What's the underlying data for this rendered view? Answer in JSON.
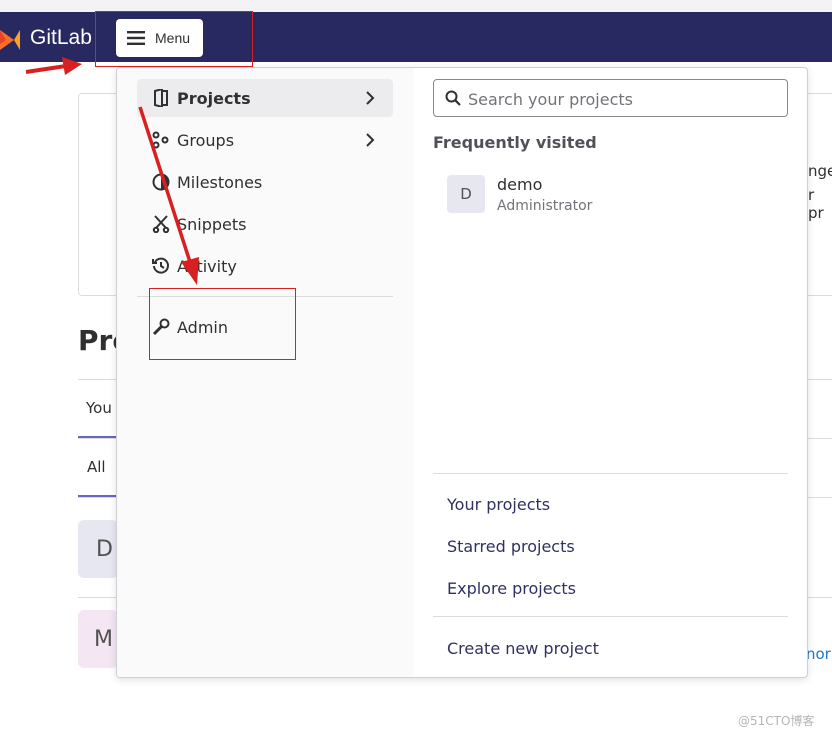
{
  "header": {
    "brand": "GitLab",
    "menu_label": "Menu"
  },
  "background": {
    "card_text_1": "nge",
    "card_text_2": "r pr",
    "title": "Pro",
    "tab_1": "You",
    "tab_2": "All",
    "avatar_1": "D",
    "avatar_2": "M",
    "more_link": "nor"
  },
  "menu": {
    "nav_items": [
      {
        "label": "Projects",
        "icon": "project-icon",
        "has_chevron": true,
        "active": true
      },
      {
        "label": "Groups",
        "icon": "group-icon",
        "has_chevron": true,
        "active": false
      },
      {
        "label": "Milestones",
        "icon": "milestone-icon",
        "has_chevron": false,
        "active": false
      },
      {
        "label": "Snippets",
        "icon": "snippet-icon",
        "has_chevron": false,
        "active": false
      },
      {
        "label": "Activity",
        "icon": "history-icon",
        "has_chevron": false,
        "active": false
      }
    ],
    "admin": {
      "label": "Admin",
      "icon": "admin-wrench-icon"
    },
    "search": {
      "placeholder": "Search your projects",
      "value": ""
    },
    "frequently_visited": {
      "title": "Frequently visited",
      "projects": [
        {
          "avatar": "D",
          "name": "demo",
          "namespace": "Administrator"
        }
      ]
    },
    "links": [
      "Your projects",
      "Starred projects",
      "Explore projects"
    ],
    "create_link": "Create new project"
  },
  "watermark": "@51CTO博客",
  "colors": {
    "navbar": "#292961",
    "annotation": "#d82020",
    "link": "#303062"
  }
}
